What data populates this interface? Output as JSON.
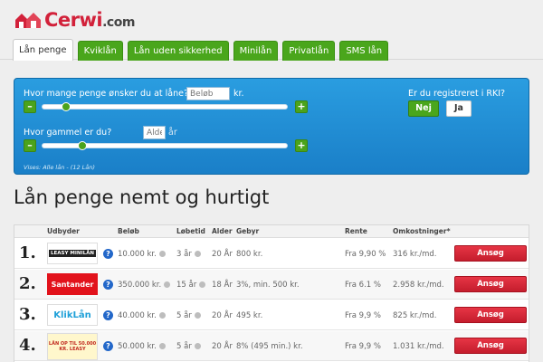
{
  "brand": {
    "name": "Cerwi",
    "domain": ".com",
    "color": "#d2213a"
  },
  "tabs": [
    {
      "label": "Lån penge",
      "active": true
    },
    {
      "label": "Kviklån"
    },
    {
      "label": "Lån uden sikkerhed"
    },
    {
      "label": "Minilån"
    },
    {
      "label": "Privatlån"
    },
    {
      "label": "SMS lån"
    }
  ],
  "calculator": {
    "amount_question": "Hvor mange penge ønsker du at låne?",
    "amount_placeholder": "Beløb",
    "amount_unit": "kr.",
    "age_question": "Hvor gammel er du?",
    "age_placeholder": "Alder",
    "age_unit": "år",
    "minus": "–",
    "plus": "+",
    "rki_question": "Er du registreret i RKI?",
    "rki_no": "Nej",
    "rki_yes": "Ja",
    "vises": "Vises: Alle lån - (12 Lån)"
  },
  "page_title": "Lån penge nemt og hurtigt",
  "table": {
    "headers": [
      "Udbyder",
      "Beløb",
      "Løbetid",
      "Alder",
      "Gebyr",
      "Rente",
      "Omkostninger*"
    ],
    "rows": [
      {
        "num": "1.",
        "lender": "LEASY MINILÅN",
        "amount": "10.000 kr.",
        "term": "3 år",
        "age": "20 År",
        "fee": "800 kr.",
        "rate": "Fra 9,90 %",
        "cost": "316 kr./md.",
        "apply": "Ansøg"
      },
      {
        "num": "2.",
        "lender": "Santander",
        "amount": "350.000 kr.",
        "term": "15 år",
        "age": "18 År",
        "fee": "3%, min. 500 kr.",
        "rate": "Fra 6.1 %",
        "cost": "2.958 kr./md.",
        "apply": "Ansøg"
      },
      {
        "num": "3.",
        "lender": "KlikLån",
        "amount": "40.000 kr.",
        "term": "5 år",
        "age": "20 År",
        "fee": "495 kr.",
        "rate": "Fra 9,9 %",
        "cost": "825 kr./md.",
        "apply": "Ansøg"
      },
      {
        "num": "4.",
        "lender": "LÅN OP TIL 50.000 KR. LEASY",
        "amount": "50.000 kr.",
        "term": "5 år",
        "age": "20 År",
        "fee": "8% (495 min.) kr.",
        "rate": "Fra 9,9 %",
        "cost": "1.031 kr./md.",
        "apply": "Ansøg"
      }
    ]
  },
  "colors": {
    "green": "#4aa61c",
    "blue": "#1a7fc8",
    "red": "#d11f30"
  }
}
